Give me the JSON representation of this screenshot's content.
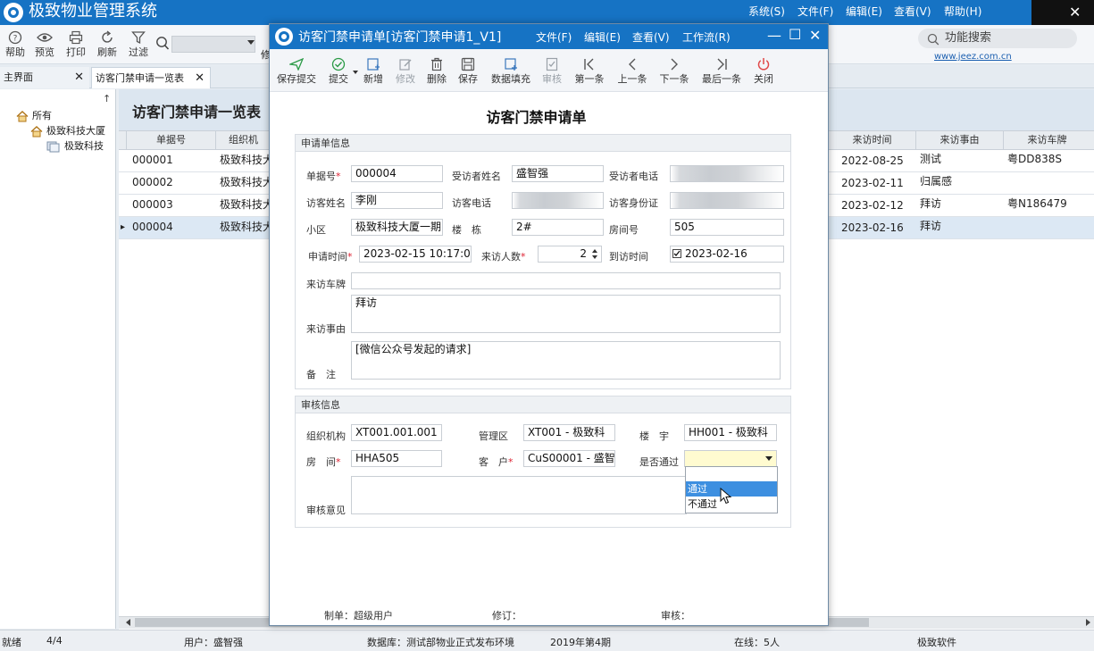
{
  "app": {
    "title": "极致物业管理系统",
    "menu": [
      "系统(S)",
      "文件(F)",
      "编辑(E)",
      "查看(V)",
      "帮助(H)"
    ]
  },
  "toolbar": {
    "buttons": [
      {
        "label": "帮助",
        "icon": "help-icon"
      },
      {
        "label": "预览",
        "icon": "eye-icon"
      },
      {
        "label": "打印",
        "icon": "printer-icon"
      },
      {
        "label": "刷新",
        "icon": "refresh-icon"
      },
      {
        "label": "过滤",
        "icon": "filter-icon"
      }
    ],
    "partial_label": "修",
    "func_search": "功能搜索",
    "site_link": "www.jeez.com.cn"
  },
  "tabs": [
    {
      "label": "主界面"
    },
    {
      "label": "访客门禁申请一览表"
    }
  ],
  "tree": {
    "pin": "↑",
    "nodes": [
      "所有",
      "极致科技大厦",
      "极致科技"
    ]
  },
  "list": {
    "title": "访客门禁申请一览表",
    "columns": {
      "no": "单据号",
      "org": "组织机",
      "visit_time": "来访时间",
      "reason": "来访事由",
      "plate": "来访车牌"
    },
    "rows": [
      {
        "no": "000001",
        "org": "极致科技大",
        "visit_time": "2022-08-25",
        "reason": "测试",
        "plate": "粤DD838S"
      },
      {
        "no": "000002",
        "org": "极致科技大",
        "visit_time": "2023-02-11",
        "reason": "归属感",
        "plate": ""
      },
      {
        "no": "000003",
        "org": "极致科技大",
        "visit_time": "2023-02-12",
        "reason": "拜访",
        "plate": "粤N186479"
      },
      {
        "no": "000004",
        "org": "极致科技大",
        "visit_time": "2023-02-16",
        "reason": "拜访",
        "plate": ""
      }
    ],
    "selected_marker": "▸"
  },
  "status": {
    "ready": "就绪",
    "count": "4/4",
    "user": "用户：盛智强",
    "db": "数据库：测试部物业正式发布环境",
    "period": "2019年第4期",
    "online": "在线：5人",
    "company": "极致软件"
  },
  "dialog": {
    "title": "访客门禁申请单[访客门禁申请1_V1]",
    "menu": [
      "文件(F)",
      "编辑(E)",
      "查看(V)",
      "工作流(R)"
    ],
    "controls": {
      "min": "—",
      "max": "☐",
      "close": "✕"
    },
    "toolbar": [
      {
        "label": "保存提交",
        "icon": "send-icon"
      },
      {
        "label": "提交",
        "icon": "check-circle-icon"
      },
      {
        "label": "新增",
        "icon": "add-doc-icon"
      },
      {
        "label": "修改",
        "icon": "edit-icon"
      },
      {
        "label": "删除",
        "icon": "trash-icon"
      },
      {
        "label": "保存",
        "icon": "save-icon"
      },
      {
        "label": "数据填充",
        "icon": "fill-icon"
      },
      {
        "label": "审核",
        "icon": "audit-icon"
      },
      {
        "label": "第一条",
        "icon": "first-icon"
      },
      {
        "label": "上一条",
        "icon": "prev-icon"
      },
      {
        "label": "下一条",
        "icon": "next-icon"
      },
      {
        "label": "最后一条",
        "icon": "last-icon"
      },
      {
        "label": "关闭",
        "icon": "power-icon"
      }
    ],
    "form_title": "访客门禁申请单",
    "section1": "申请单信息",
    "section2": "审核信息",
    "labels": {
      "doc_no": "单据号",
      "host_name": "受访者姓名",
      "host_phone": "受访者电话",
      "visitor_name": "访客姓名",
      "visitor_phone": "访客电话",
      "visitor_id": "访客身份证",
      "community": "小区",
      "building": "楼　栋",
      "room": "房间号",
      "apply_time": "申请时间",
      "visitor_count": "来访人数",
      "arrive_time": "到访时间",
      "plate": "来访车牌",
      "reason": "来访事由",
      "remark": "备　注",
      "org": "组织机构",
      "mgmt_area": "管理区",
      "tower": "楼　宇",
      "house": "房　间",
      "customer": "客　户",
      "approved": "是否通过",
      "opinion": "审核意见"
    },
    "values": {
      "doc_no": "000004",
      "host_name": "盛智强",
      "visitor_name": "李刚",
      "community": "极致科技大厦一期",
      "building": "2#",
      "room": "505",
      "apply_time": "2023-02-15 10:17:00",
      "visitor_count": "2",
      "arrive_time": "2023-02-16",
      "plate": "",
      "reason": "拜访",
      "remark": "[微信公众号发起的请求]",
      "org": "XT001.001.001 -",
      "mgmt_area": "XT001 - 极致科",
      "tower": "HH001 - 极致科",
      "house": "HHA505",
      "customer": "CuS00001 - 盛智",
      "approved": "",
      "opinion": ""
    },
    "approve_options": [
      "通过",
      "不通过"
    ],
    "req_mark": "*",
    "footer": {
      "maker": "制单：超级用户",
      "modifier": "修订：",
      "auditor": "审核："
    }
  },
  "colors": {
    "titlebar": "#1673c4",
    "selection": "#3d8fe0",
    "dropdown_field": "#fffbd0"
  }
}
